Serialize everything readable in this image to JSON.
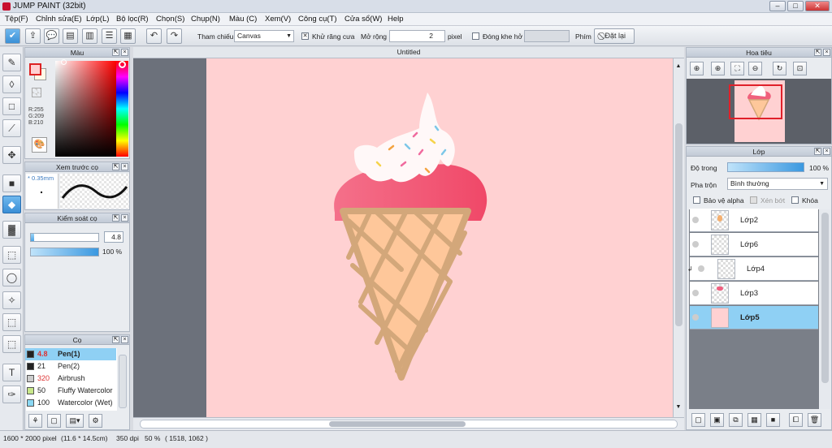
{
  "window": {
    "title": "JUMP PAINT (32bit)",
    "min": "–",
    "max": "□",
    "close": "✕"
  },
  "menu": [
    "Tệp(F)",
    "Chỉnh sửa(E)",
    "Lớp(L)",
    "Bộ lọc(R)",
    "Chọn(S)",
    "Chụp(N)",
    "Màu (C)",
    "Xem(V)",
    "Công cụ(T)",
    "Cửa sổ(W)",
    "Help"
  ],
  "toolbar": {
    "ref_label": "Tham chiếu",
    "ref_value": "Canvas",
    "antialias_label": "Khử răng cưa",
    "antialias_checked": "✕",
    "expand_label": "Mở rộng",
    "expand_value": "2",
    "expand_unit": "pixel",
    "close_gap_label": "Đóng khe hở",
    "key_label": "Phím",
    "reset_label": "Đặt lại"
  },
  "color_panel": {
    "title": "Màu",
    "r": "R:255",
    "g": "G:209",
    "b": "B:210",
    "fg": "#ffd1d2",
    "bg": "#fffbe8"
  },
  "brush_preview": {
    "title": "Xem trước cọ",
    "size": "* 0.35mm"
  },
  "brush_control": {
    "title": "Kiểm soát cọ",
    "size_value": "4.8",
    "size_fraction": 0.05,
    "opacity_value": "100 %",
    "opacity_fraction": 1.0
  },
  "brush_list": {
    "title": "Cọ",
    "items": [
      {
        "size": "4.8",
        "name": "Pen(1)",
        "swatch": "#222222",
        "selected": true
      },
      {
        "size": "21",
        "name": "Pen(2)",
        "swatch": "#222222",
        "selected": false
      },
      {
        "size": "320",
        "name": "Airbrush",
        "swatch": "#cccccc",
        "selected": false
      },
      {
        "size": "50",
        "name": "Fluffy Watercolor",
        "swatch": "#c8e88a",
        "selected": false
      },
      {
        "size": "100",
        "name": "Watercolor (Wet)",
        "swatch": "#8ad8f4",
        "selected": false
      }
    ]
  },
  "canvas": {
    "title": "Untitled",
    "background": "#ffd1d2"
  },
  "navigator": {
    "title": "Hoa tiêu"
  },
  "layers": {
    "title": "Lớp",
    "opacity_label": "Độ trong",
    "opacity_value": "100 %",
    "blend_label": "Pha trộn",
    "blend_value": "Bình thường",
    "protect_alpha": "Bảo vệ alpha",
    "clip": "Xén bớt",
    "lock": "Khóa",
    "items": [
      {
        "name": "Lớp2",
        "selected": false
      },
      {
        "name": "Lớp6",
        "selected": false
      },
      {
        "name": "Lớp4",
        "selected": false
      },
      {
        "name": "Lớp3",
        "selected": false
      },
      {
        "name": "Lớp5",
        "selected": true
      }
    ]
  },
  "status": {
    "size": "1600 * 2000 pixel",
    "phys": "(11.6 * 14.5cm)",
    "dpi": "350 dpi",
    "zoom": "50 %",
    "coords": "( 1518, 1062 )"
  }
}
